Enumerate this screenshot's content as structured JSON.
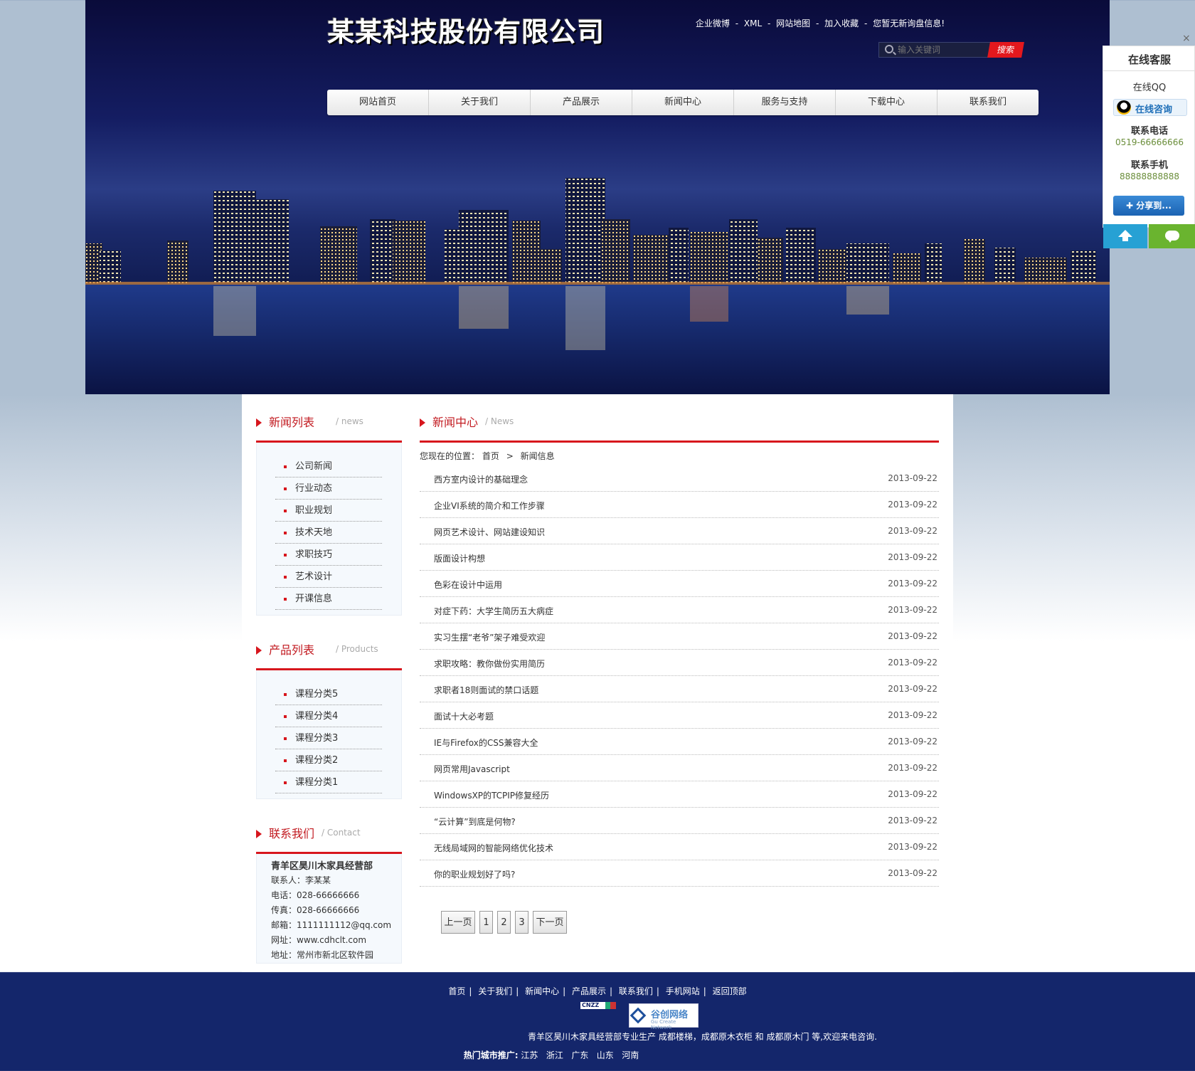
{
  "header": {
    "site_title": "某某科技股份有限公司",
    "top_links": [
      "企业微博",
      "XML",
      "网站地图",
      "加入收藏",
      "您暂无新询盘信息!"
    ],
    "top_sep": "-",
    "search_placeholder": "输入关键词",
    "search_button": "搜索"
  },
  "nav": [
    "网站首页",
    "关于我们",
    "产品展示",
    "新闻中心",
    "服务与支持",
    "下载中心",
    "联系我们"
  ],
  "service_panel": {
    "title": "在线客服",
    "qq_label": "在线QQ",
    "qq_button": "在线咨询",
    "phone_label": "联系电话",
    "phone": "0519-66666666",
    "mobile_label": "联系手机",
    "mobile": "88888888888",
    "share_button": "分享到...",
    "close": "×"
  },
  "sidebar": {
    "news": {
      "title": "新闻列表",
      "sub": "/ news",
      "items": [
        "公司新闻",
        "行业动态",
        "职业规划",
        "技术天地",
        "求职技巧",
        "艺术设计",
        "开课信息"
      ]
    },
    "products": {
      "title": "产品列表",
      "sub": "/ Products",
      "items": [
        "课程分类5",
        "课程分类4",
        "课程分类3",
        "课程分类2",
        "课程分类1"
      ]
    },
    "contact": {
      "title": "联系我们",
      "sub": "/ Contact",
      "company": "青羊区昊川木家具经营部",
      "lines": [
        "联系人：李某某",
        "电话：028-66666666",
        "传真：028-66666666",
        "邮箱：1111111112@qq.com",
        "网址：www.cdhclt.com",
        "地址：常州市新北区软件园"
      ]
    }
  },
  "main": {
    "title": "新闻中心",
    "sub": "/ News",
    "breadcrumb_prefix": "您现在的位置：",
    "breadcrumb_home": "首页",
    "breadcrumb_sep": ">",
    "breadcrumb_current": "新闻信息",
    "news": [
      {
        "title": "西方室内设计的基础理念",
        "date": "2013-09-22"
      },
      {
        "title": "企业VI系统的简介和工作步骤",
        "date": "2013-09-22"
      },
      {
        "title": "网页艺术设计、网站建设知识",
        "date": "2013-09-22"
      },
      {
        "title": "版面设计构想",
        "date": "2013-09-22"
      },
      {
        "title": "色彩在设计中运用",
        "date": "2013-09-22"
      },
      {
        "title": "对症下药：大学生简历五大病症",
        "date": "2013-09-22"
      },
      {
        "title": "实习生摆“老爷”架子难受欢迎",
        "date": "2013-09-22"
      },
      {
        "title": "求职攻略：教你做份实用简历",
        "date": "2013-09-22"
      },
      {
        "title": "求职者18则面试的禁口话题",
        "date": "2013-09-22"
      },
      {
        "title": "面试十大必考题",
        "date": "2013-09-22"
      },
      {
        "title": "IE与Firefox的CSS兼容大全",
        "date": "2013-09-22"
      },
      {
        "title": "网页常用Javascript",
        "date": "2013-09-22"
      },
      {
        "title": "WindowsXP的TCPIP修复经历",
        "date": "2013-09-22"
      },
      {
        "title": "“云计算”到底是何物?",
        "date": "2013-09-22"
      },
      {
        "title": "无线局域网的智能网络优化技术",
        "date": "2013-09-22"
      },
      {
        "title": "你的职业规划好了吗?",
        "date": "2013-09-22"
      }
    ],
    "pager": {
      "prev": "上一页",
      "pages": [
        "1",
        "2",
        "3"
      ],
      "next": "下一页"
    }
  },
  "footer": {
    "links": [
      "首页",
      "关于我们",
      "新闻中心",
      "产品展示",
      "联系我们",
      "手机网站",
      "返回顶部"
    ],
    "link_sep": "|",
    "cnzz": "CNZZ",
    "partner_name": "谷创网络",
    "partner_sub": "Gu Create Network",
    "description": "青羊区昊川木家具经营部专业生产  成都楼梯，成都原木衣柜 和 成都原木门 等,欢迎来电咨询.",
    "hot_label": "热门城市推广:",
    "hot_cities": [
      "江苏",
      "浙江",
      "广东",
      "山东",
      "河南"
    ]
  },
  "colors": {
    "accent_red": "#d7161d",
    "banner_navy": "#141d62",
    "footer_navy": "#14266b",
    "share_blue": "#1b63b3",
    "top_btn_blue": "#27a1d4",
    "chat_green": "#6ab42f"
  }
}
